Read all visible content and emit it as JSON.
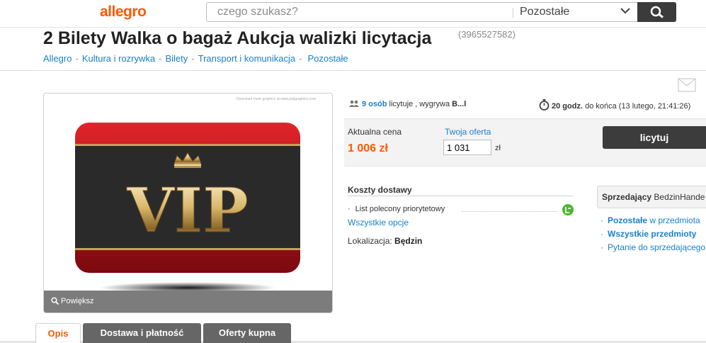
{
  "header": {
    "logo": "allegro",
    "search_placeholder": "czego szukasz?",
    "category": "Pozostałe"
  },
  "offer": {
    "title": "2 Bilety Walka o bagaż Aukcja walizki licytacja",
    "id": "(3965527582)"
  },
  "breadcrumb": [
    "Allegro",
    "Kultura i rozrywka",
    "Bilety",
    "Transport i komunikacja",
    "Pozostałe"
  ],
  "gallery": {
    "credit": "Download more graphics at www.psdgraphics.com",
    "image_text": "VIP",
    "zoom_label": "Powiększ"
  },
  "auction": {
    "bidders_count": "9 osób",
    "bidders_text": "licytuje , wygrywa",
    "winner": "B...l",
    "time_left": "20 godz.",
    "time_text": "do końca (13 lutego, 21:41:26)",
    "price_label": "Aktualna cena",
    "price": "1 006 zł",
    "your_offer_label": "Twoja oferta",
    "your_offer_value": "1 031",
    "currency": "zł",
    "bid_button": "licytuj"
  },
  "shipping": {
    "title": "Koszty dostawy",
    "item": "List polecony priorytetowy",
    "all_options": "Wszystkie opcje",
    "location_label": "Lokalizacja:",
    "location": "Będzin"
  },
  "seller": {
    "label": "Sprzedający",
    "name": "BedzinHande",
    "link1_bold": "Pozostałe",
    "link1_rest": "w przedmiota",
    "link2": "Wszystkie przedmioty",
    "link3": "Pytanie do sprzedającego"
  },
  "tabs": [
    "Opis",
    "Dostawa i płatność",
    "Oferty kupna"
  ],
  "colors": {
    "accent": "#ff5a00",
    "link": "#1a80c9"
  }
}
